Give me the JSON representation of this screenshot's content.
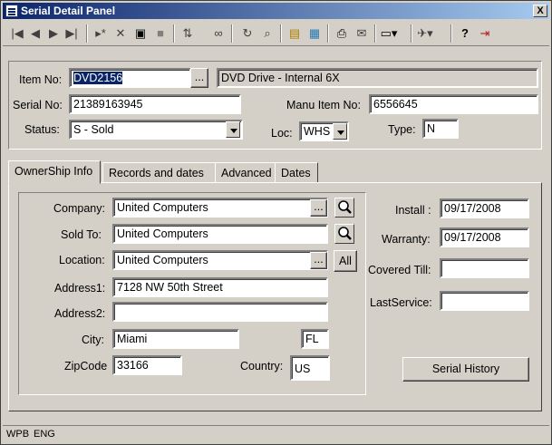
{
  "window": {
    "title": "Serial Detail Panel",
    "close": "X"
  },
  "header": {
    "item_no_label": "Item No:",
    "item_no_value": "DVD2156",
    "item_desc": "DVD Drive - Internal 6X",
    "serial_no_label": "Serial No:",
    "serial_no_value": "21389163945",
    "manu_item_label": "Manu Item No:",
    "manu_item_value": "6556645",
    "status_label": "Status:",
    "status_value": "S - Sold",
    "loc_label": "Loc:",
    "loc_value": "WHS",
    "type_label": "Type:",
    "type_value": "N",
    "ellipsis": "..."
  },
  "tabs": [
    "OwnerShip Info",
    "Records and  dates",
    "Advanced",
    "Dates"
  ],
  "ownership": {
    "company_label": "Company:",
    "company_value": "United Computers",
    "soldto_label": "Sold To:",
    "soldto_value": "United Computers",
    "location_label": "Location:",
    "location_value": "United Computers",
    "all_button": "All",
    "address1_label": "Address1:",
    "address1_value": "7128 NW 50th Street",
    "address2_label": "Address2:",
    "address2_value": "",
    "city_label": "City:",
    "city_value": "Miami",
    "state_value": "FL",
    "zip_label": "ZipCode",
    "zip_value": "33166",
    "country_label": "Country:",
    "country_value": "US",
    "ellipsis": "..."
  },
  "dates": {
    "install_label": "Install :",
    "install_value": "09/17/2008",
    "warranty_label": "Warranty:",
    "warranty_value": "09/17/2008",
    "covered_label": "Covered Till:",
    "covered_value": "",
    "lastservice_label": "LastService:",
    "lastservice_value": "",
    "history_button": "Serial History"
  },
  "statusbar": {
    "left": "WPB",
    "right": "ENG"
  }
}
